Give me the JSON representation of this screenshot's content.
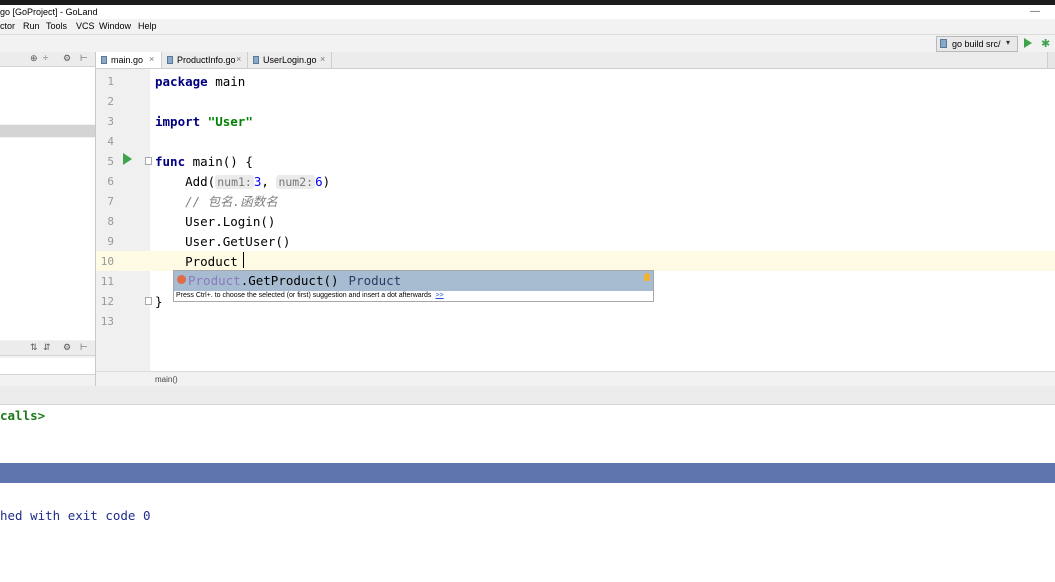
{
  "window": {
    "title": "go [GoProject] - GoLand",
    "minimize": "—",
    "close": "✕"
  },
  "menu": [
    "ctor",
    "Run",
    "Tools",
    "VCS",
    "Window",
    "Help"
  ],
  "navbar": {
    "run_config": "go build src/",
    "run_config_chevron": "▾"
  },
  "left_panel": {
    "top_icons": [
      "⊕",
      "÷",
      "⚙",
      "⊢"
    ],
    "bottom_icons": [
      "⇅",
      "⇵",
      "⚙",
      "⊢"
    ]
  },
  "tabs": [
    {
      "label": "main.go",
      "active": true
    },
    {
      "label": "ProductInfo.go",
      "active": false
    },
    {
      "label": "UserLogin.go",
      "active": false
    }
  ],
  "tab_close": "×",
  "editor": {
    "line_numbers": [
      "1",
      "2",
      "3",
      "4",
      "5",
      "6",
      "7",
      "8",
      "9",
      "10",
      "11",
      "12",
      "13"
    ],
    "code": {
      "l1_kw": "package",
      "l1_rest": " main",
      "l3_kw": "import",
      "l3_str": "\"User\"",
      "l5_kw": "func",
      "l5_rest": " main() {",
      "l6_pre": "    Add(",
      "l6_hint1": "num1:",
      "l6_v1": "3",
      "l6_mid": ", ",
      "l6_hint2": "num2:",
      "l6_v2": "6",
      "l6_post": ")",
      "l7_comment": "    // 包名.函数名",
      "l8": "    User.Login()",
      "l9": "    User.GetUser()",
      "l10": "    Product",
      "l12": "}"
    },
    "completion": {
      "package_part": "Product",
      "function_part": ".GetProduct()",
      "return_type": "Product",
      "tip": "Press Ctrl+. to choose the selected (or first) suggestion and insert a dot afterwards",
      "tip_link": ">>"
    },
    "breadcrumb": "main()"
  },
  "console": {
    "calls_line": "calls>",
    "exit_line": "hed with exit code 0"
  }
}
